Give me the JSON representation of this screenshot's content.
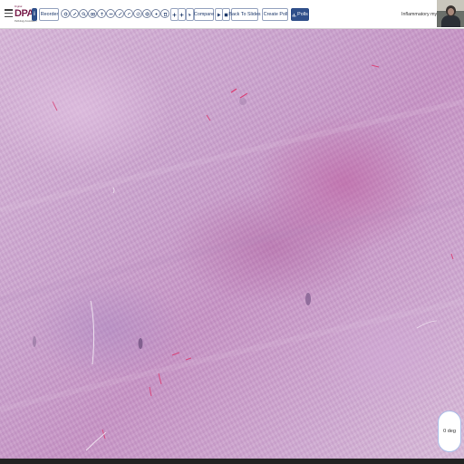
{
  "toolbar": {
    "logo_text": "DPA",
    "logo_top": "Digital",
    "logo_sub": "Pathology Association",
    "info_label": "i",
    "reorder_label": "Reorder",
    "compare_label": "Compare",
    "back_to_slides_label": "Back To Slides",
    "create_poll_label": "Create Poll",
    "polls_label": "Polls"
  },
  "slide": {
    "title": "Inflammatory myofibrobl"
  },
  "rotation": {
    "label": "0 deg"
  },
  "colors": {
    "primary": "#2f4f8a",
    "button_border": "#9aa7c2",
    "tissue_base": "#caa3cd",
    "dial_border": "#a9bde8"
  },
  "icons": [
    "menu-icon",
    "reorder-icon",
    "annotation-icons",
    "zoom-in-icon",
    "zoom-out-icon",
    "pointer-icon",
    "compare-icon",
    "play-icon",
    "stop-icon",
    "create-poll-icon",
    "polls-icon"
  ]
}
